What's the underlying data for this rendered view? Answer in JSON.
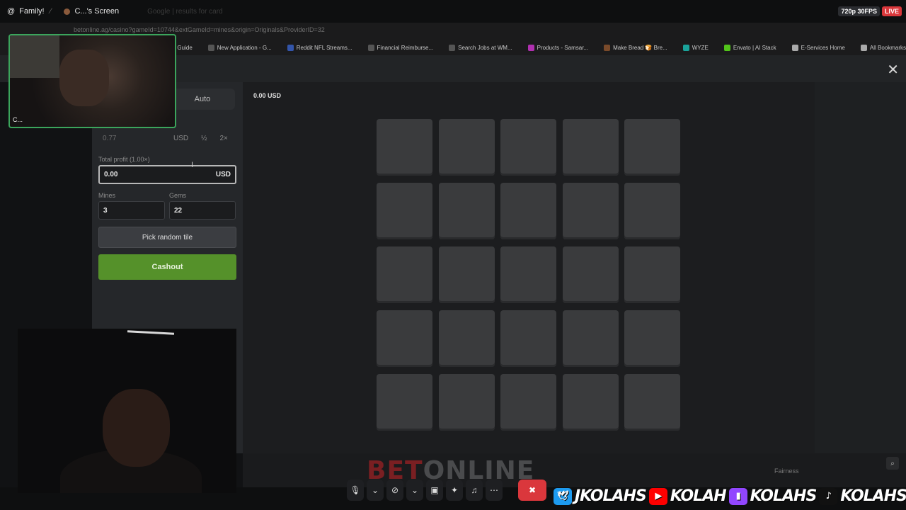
{
  "discord": {
    "server": "Family!",
    "channel": "C...'s Screen",
    "faded_tab": "Google | results for card",
    "quality": "720p 30FPS",
    "live": "LIVE"
  },
  "browser": {
    "url": "betonline.ag/casino?gameId=10744&extGameId=mines&origin=Originals&ProviderID=32",
    "bookmarks": [
      {
        "label": "FAR Study Guide",
        "color": "#2d6cdf"
      },
      {
        "label": "New Application - G...",
        "color": "#555"
      },
      {
        "label": "Reddit NFL Streams...",
        "color": "#3355aa"
      },
      {
        "label": "Financial Reimburse...",
        "color": "#555"
      },
      {
        "label": "Search Jobs at WM...",
        "color": "#555"
      },
      {
        "label": "Products - Samsar...",
        "color": "#b030b0"
      },
      {
        "label": "Make Bread 🍞 Bre...",
        "color": "#7a4a2a"
      },
      {
        "label": "WYZE",
        "color": "#1aa39a"
      },
      {
        "label": "Envato | AI Stack",
        "color": "#52c41a"
      },
      {
        "label": "E-Services Home",
        "color": "#aaa"
      },
      {
        "label": "All Bookmarks",
        "color": "#aaa"
      }
    ]
  },
  "game": {
    "auto_tab": "Auto",
    "bet_amount": "0.77",
    "bet_currency": "USD",
    "half_label": "½",
    "double_label": "2×",
    "profit_label": "Total profit (1.00×)",
    "profit_value": "0.00",
    "profit_currency": "USD",
    "mines_label": "Mines",
    "mines_value": "3",
    "gems_label": "Gems",
    "gems_value": "22",
    "random_label": "Pick random tile",
    "cashout_label": "Cashout",
    "balance": "0.00 USD",
    "grid_rows": 5,
    "grid_cols": 5,
    "fairness": "Fairness",
    "logo_red": "BET",
    "logo_rest": "ONLINE"
  },
  "webcam_top_name": "C...",
  "socials": [
    {
      "handle": "JKOLAHS",
      "icon": "twitter-icon",
      "color": "#1d9bf0"
    },
    {
      "handle": "KOLAH",
      "icon": "youtube-icon",
      "color": "#ff0000"
    },
    {
      "handle": "KOLAHS",
      "icon": "twitch-icon",
      "color": "#9146ff"
    },
    {
      "handle": "KOLAHS",
      "icon": "tiktok-icon",
      "color": "#111"
    }
  ]
}
